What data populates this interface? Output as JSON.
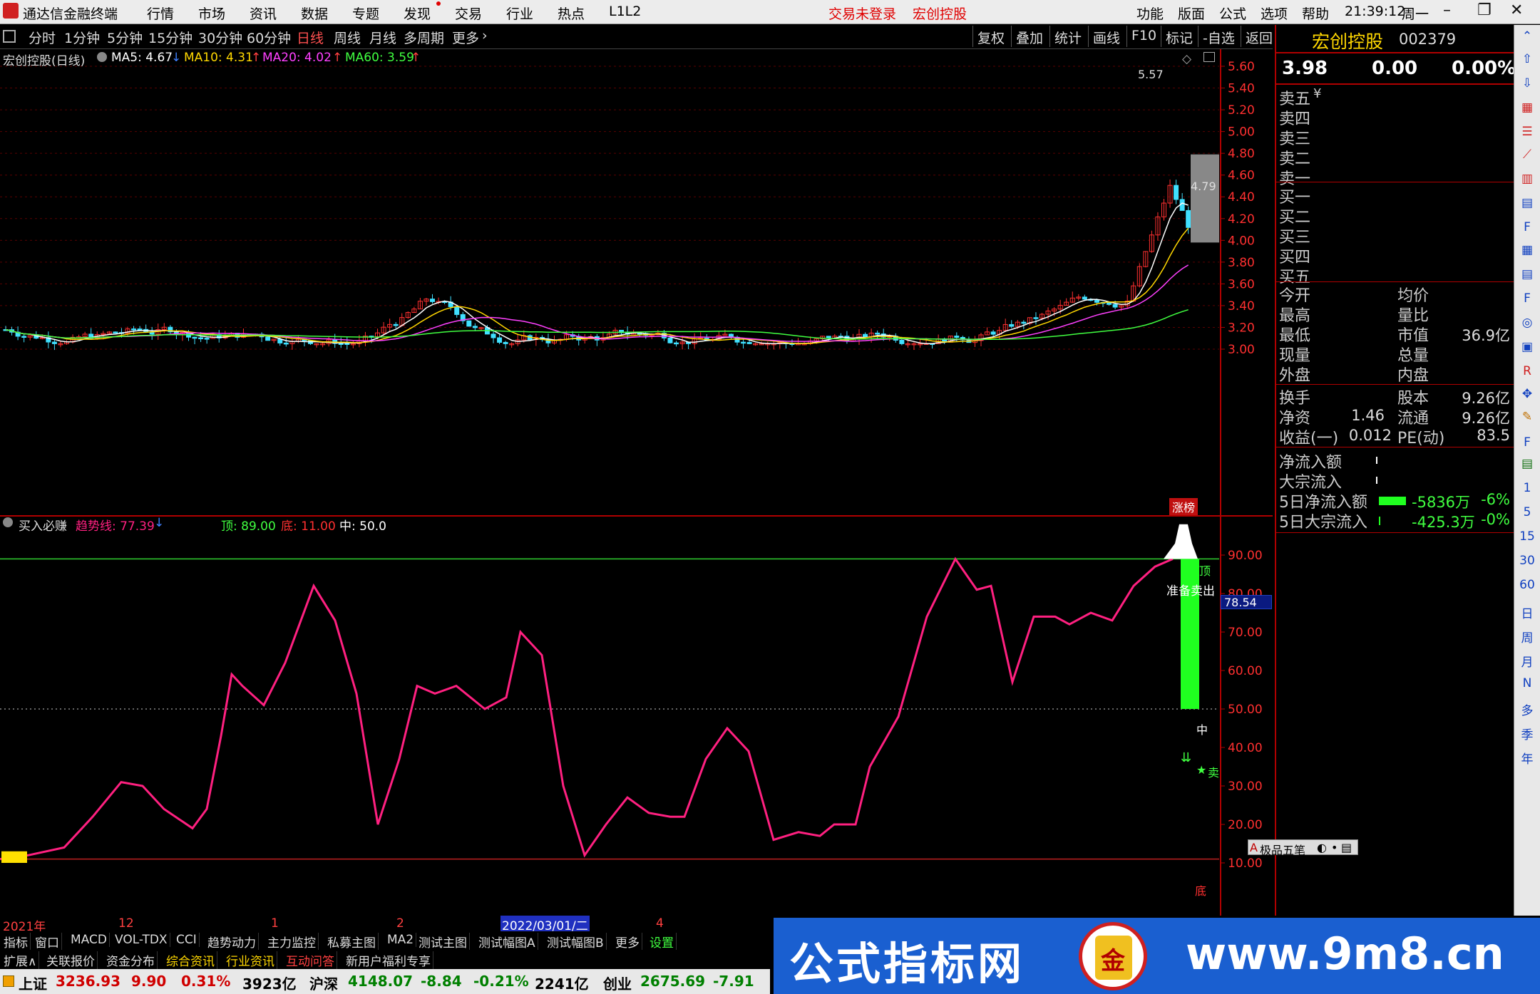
{
  "menubar": {
    "app_title": "通达信金融终端",
    "menus": [
      "行情",
      "市场",
      "资讯",
      "数据",
      "专题",
      "发现",
      "交易",
      "行业",
      "热点",
      "L1L2"
    ],
    "status_red": [
      "交易未登录",
      "宏创控股"
    ],
    "right_menus": [
      "功能",
      "版面",
      "公式",
      "选项",
      "帮助"
    ],
    "clock": "21:39:12",
    "weekday": "周一"
  },
  "timeframes": [
    "分时",
    "1分钟",
    "5分钟",
    "15分钟",
    "30分钟",
    "60分钟",
    "日线",
    "周线",
    "月线",
    "多周期",
    "更多"
  ],
  "active_timeframe": "日线",
  "toolbar_right": [
    "复权",
    "叠加",
    "统计",
    "画线",
    "F10",
    "标记",
    "-自选",
    "返回"
  ],
  "main": {
    "title": "宏创控股(日线)",
    "ma": [
      {
        "label": "MA5: 4.67",
        "color": "#ffffff",
        "arrow": "down"
      },
      {
        "label": "MA10: 4.31",
        "color": "#ffd700",
        "arrow": "up"
      },
      {
        "label": "MA20: 4.02",
        "color": "#ff40ff",
        "arrow": "up"
      },
      {
        "label": "MA60: 3.59",
        "color": "#40ff40",
        "arrow": "up"
      }
    ],
    "price_axis": [
      "5.60",
      "5.40",
      "5.20",
      "5.00",
      "4.80",
      "4.60",
      "4.40",
      "4.20",
      "4.00",
      "3.80",
      "3.60",
      "3.40",
      "3.20",
      "3.00"
    ],
    "high_label": "5.57",
    "close_label": "4.79",
    "zt_label": "涨榜"
  },
  "indicator": {
    "name": "买入必赚",
    "trend_label": "趋势线: 77.39",
    "top_label": "顶: 89.00",
    "bottom_label": "底: 11.00",
    "mid_label": "中: 50.0",
    "axis": [
      "90.00",
      "80.00",
      "70.00",
      "60.00",
      "50.00",
      "40.00",
      "30.00",
      "20.00",
      "10.00"
    ],
    "cur_value": "78.54",
    "sig_top": "顶",
    "sig_prep": "准备卖出",
    "sig_mid": "中",
    "sig_sell": "卖",
    "sig_bottom": "底"
  },
  "datebar": {
    "labels": [
      "2021年",
      "12",
      "1",
      "2",
      "2022/03/01/二",
      "4"
    ]
  },
  "tabs1": [
    "指标",
    "窗口",
    "MACD",
    "VOL-TDX",
    "CCI",
    "趋势动力",
    "主力监控",
    "私募主图",
    "MA2",
    "测试主图",
    "测试幅图A",
    "测试幅图B",
    "更多",
    "设置"
  ],
  "tabs2": [
    "扩展∧",
    "关联报价",
    "资金分布",
    "综合资讯",
    "行业资讯",
    "互动问答",
    "新用户福利专享"
  ],
  "status": {
    "sh_name": "上证",
    "sh_idx": "3236.93",
    "sh_chg": "9.90",
    "sh_pct": "0.31%",
    "sh_amt": "3923亿",
    "hs_name": "沪深",
    "hs_idx": "4148.07",
    "hs_chg": "-8.84",
    "hs_pct": "-0.21%",
    "hs_amt": "2241亿",
    "cy_name": "创业",
    "cy_idx": "2675.69",
    "cy_chg": "-7.91"
  },
  "quote": {
    "name": "宏创控股",
    "code": "002379",
    "price": "3.98",
    "change": "0.00",
    "pct": "0.00%",
    "sell": [
      "卖五",
      "卖四",
      "卖三",
      "卖二",
      "卖一"
    ],
    "sell_symbol": "¥",
    "buy": [
      "买一",
      "买二",
      "买三",
      "买四",
      "买五"
    ],
    "stats_left": [
      "今开",
      "最高",
      "最低",
      "现量",
      "外盘"
    ],
    "stats_right": [
      "均价",
      "量比",
      "市值",
      "总量",
      "内盘"
    ],
    "mktcap": "36.9亿",
    "fin": [
      {
        "l": "换手",
        "lv": "",
        "r": "股本",
        "rv": "9.26亿"
      },
      {
        "l": "净资",
        "lv": "1.46",
        "r": "流通",
        "rv": "9.26亿"
      },
      {
        "l": "收益(一)",
        "lv": "0.012",
        "r": "PE(动)",
        "rv": "83.5"
      }
    ],
    "flow": [
      {
        "l": "净流入额",
        "v": "",
        "p": ""
      },
      {
        "l": "大宗流入",
        "v": "",
        "p": ""
      },
      {
        "l": "5日净流入额",
        "v": "-5836万",
        "p": "-6%"
      },
      {
        "l": "5日大宗流入",
        "v": "-425.3万",
        "p": "-0%"
      }
    ]
  },
  "sidebar": [
    "1",
    "5",
    "15",
    "30",
    "60",
    "日",
    "周",
    "月",
    "N",
    "多",
    "季",
    "年"
  ],
  "yiping": "极品五笔",
  "watermark": {
    "left": "公式指标网",
    "right": "www.9m8.cn",
    "logo": "金"
  }
}
